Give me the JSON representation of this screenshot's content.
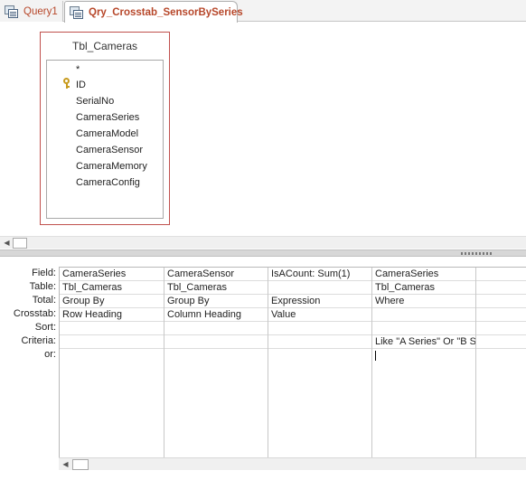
{
  "tabs": [
    {
      "label": "Query1",
      "icon": "query-icon",
      "active": false
    },
    {
      "label": "Qry_Crosstab_SensorBySeries",
      "icon": "query-icon",
      "active": true
    }
  ],
  "design": {
    "table": {
      "title": "Tbl_Cameras",
      "fields": [
        "*",
        "ID",
        "SerialNo",
        "CameraSeries",
        "CameraModel",
        "CameraSensor",
        "CameraMemory",
        "CameraConfig"
      ],
      "primary_key_field": "ID",
      "primary_key_icon": "key-icon"
    }
  },
  "grid": {
    "row_labels": [
      "Field:",
      "Table:",
      "Total:",
      "Crosstab:",
      "Sort:",
      "Criteria:",
      "or:"
    ],
    "columns": [
      {
        "field": "CameraSeries",
        "table": "Tbl_Cameras",
        "total": "Group By",
        "crosstab": "Row Heading",
        "sort": "",
        "criteria": "",
        "or": ""
      },
      {
        "field": "CameraSensor",
        "table": "Tbl_Cameras",
        "total": "Group By",
        "crosstab": "Column Heading",
        "sort": "",
        "criteria": "",
        "or": ""
      },
      {
        "field": "IsACount: Sum(1)",
        "table": "",
        "total": "Expression",
        "crosstab": "Value",
        "sort": "",
        "criteria": "",
        "or": ""
      },
      {
        "field": "CameraSeries",
        "table": "Tbl_Cameras",
        "total": "Where",
        "crosstab": "",
        "sort": "",
        "criteria": "Like \"A Series\" Or \"B Se",
        "or": ""
      },
      {
        "field": "",
        "table": "",
        "total": "",
        "crosstab": "",
        "sort": "",
        "criteria": "",
        "or": ""
      }
    ]
  },
  "icons": {
    "scroll_left": "◀",
    "scroll_right": "▶"
  },
  "colors": {
    "tab_text": "#b7472a",
    "table_border": "#c0504d"
  }
}
